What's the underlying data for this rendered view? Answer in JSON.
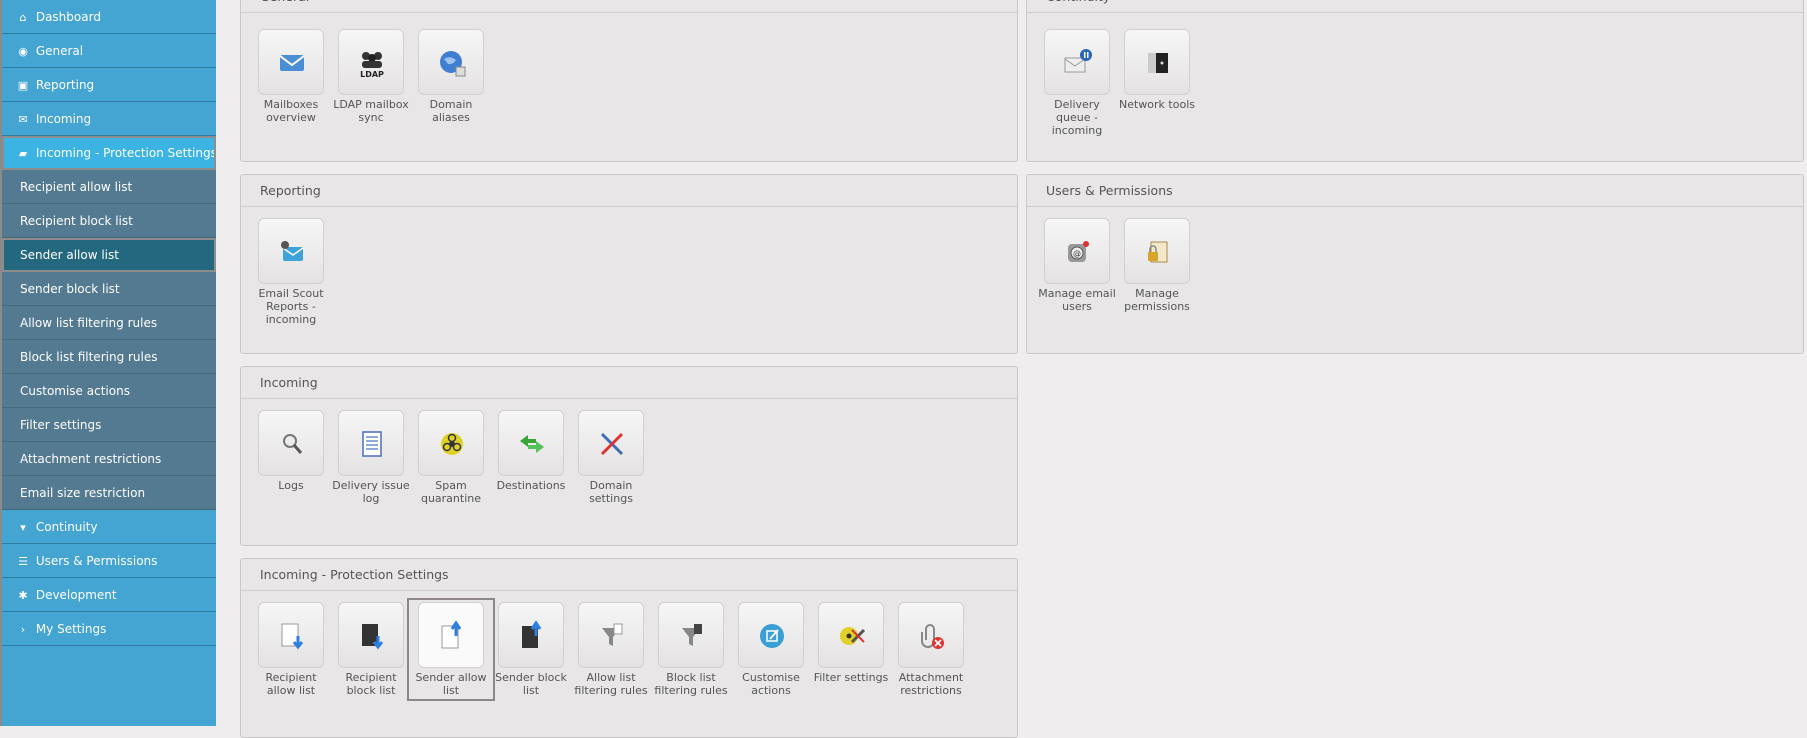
{
  "sidebar": {
    "items": [
      {
        "label": "Dashboard",
        "icon": "home-icon"
      },
      {
        "label": "General",
        "icon": "globe-icon"
      },
      {
        "label": "Reporting",
        "icon": "inbox-icon"
      },
      {
        "label": "Incoming",
        "icon": "envelope-icon"
      },
      {
        "label": "Incoming - Protection Settings",
        "icon": "folder-open-icon"
      }
    ],
    "subitems": [
      "Recipient allow list",
      "Recipient block list",
      "Sender allow list",
      "Sender block list",
      "Allow list filtering rules",
      "Block list filtering rules",
      "Customise actions",
      "Filter settings",
      "Attachment restrictions",
      "Email size restriction"
    ],
    "bottom_items": [
      {
        "label": "Continuity",
        "icon": "filter-icon"
      },
      {
        "label": "Users & Permissions",
        "icon": "list-icon"
      },
      {
        "label": "Development",
        "icon": "gear-icon"
      },
      {
        "label": "My Settings",
        "icon": "chevron-right-icon"
      }
    ]
  },
  "panels": {
    "general": {
      "title": "General",
      "tiles": [
        {
          "label": "Mailboxes overview",
          "icon": "mailbox-icon"
        },
        {
          "label": "LDAP mailbox sync",
          "icon": "ldap-icon"
        },
        {
          "label": "Domain aliases",
          "icon": "globe-icon"
        }
      ]
    },
    "continuity": {
      "title": "Continuity",
      "tiles": [
        {
          "label": "Delivery queue - incoming",
          "icon": "queue-icon"
        },
        {
          "label": "Network tools",
          "icon": "network-tools-icon"
        }
      ]
    },
    "reporting": {
      "title": "Reporting",
      "tiles": [
        {
          "label": "Email Scout Reports - incoming",
          "icon": "report-icon"
        }
      ]
    },
    "users": {
      "title": "Users & Permissions",
      "tiles": [
        {
          "label": "Manage email users",
          "icon": "email-users-icon"
        },
        {
          "label": "Manage permissions",
          "icon": "permissions-icon"
        }
      ]
    },
    "incoming": {
      "title": "Incoming",
      "tiles": [
        {
          "label": "Logs",
          "icon": "magnifier-icon"
        },
        {
          "label": "Delivery issue log",
          "icon": "document-icon"
        },
        {
          "label": "Spam quarantine",
          "icon": "biohazard-icon"
        },
        {
          "label": "Destinations",
          "icon": "arrows-icon"
        },
        {
          "label": "Domain settings",
          "icon": "tools-icon"
        }
      ]
    },
    "protection": {
      "title": "Incoming - Protection Settings",
      "tiles": [
        {
          "label": "Recipient allow list",
          "icon": "recipient-allow-icon"
        },
        {
          "label": "Recipient block list",
          "icon": "recipient-block-icon"
        },
        {
          "label": "Sender allow list",
          "icon": "sender-allow-icon"
        },
        {
          "label": "Sender block list",
          "icon": "sender-block-icon"
        },
        {
          "label": "Allow list filtering rules",
          "icon": "funnel-allow-icon"
        },
        {
          "label": "Block list filtering rules",
          "icon": "funnel-block-icon"
        },
        {
          "label": "Customise actions",
          "icon": "edit-icon"
        },
        {
          "label": "Filter settings",
          "icon": "filter-settings-icon"
        },
        {
          "label": "Attachment restrictions",
          "icon": "attachment-block-icon"
        }
      ]
    }
  },
  "colors": {
    "sidebar": "#44a4d2",
    "sidebar_active": "#3bb4e4",
    "submenu": "#537a90",
    "submenu_active": "#23687f",
    "content_bg": "#efeded"
  }
}
